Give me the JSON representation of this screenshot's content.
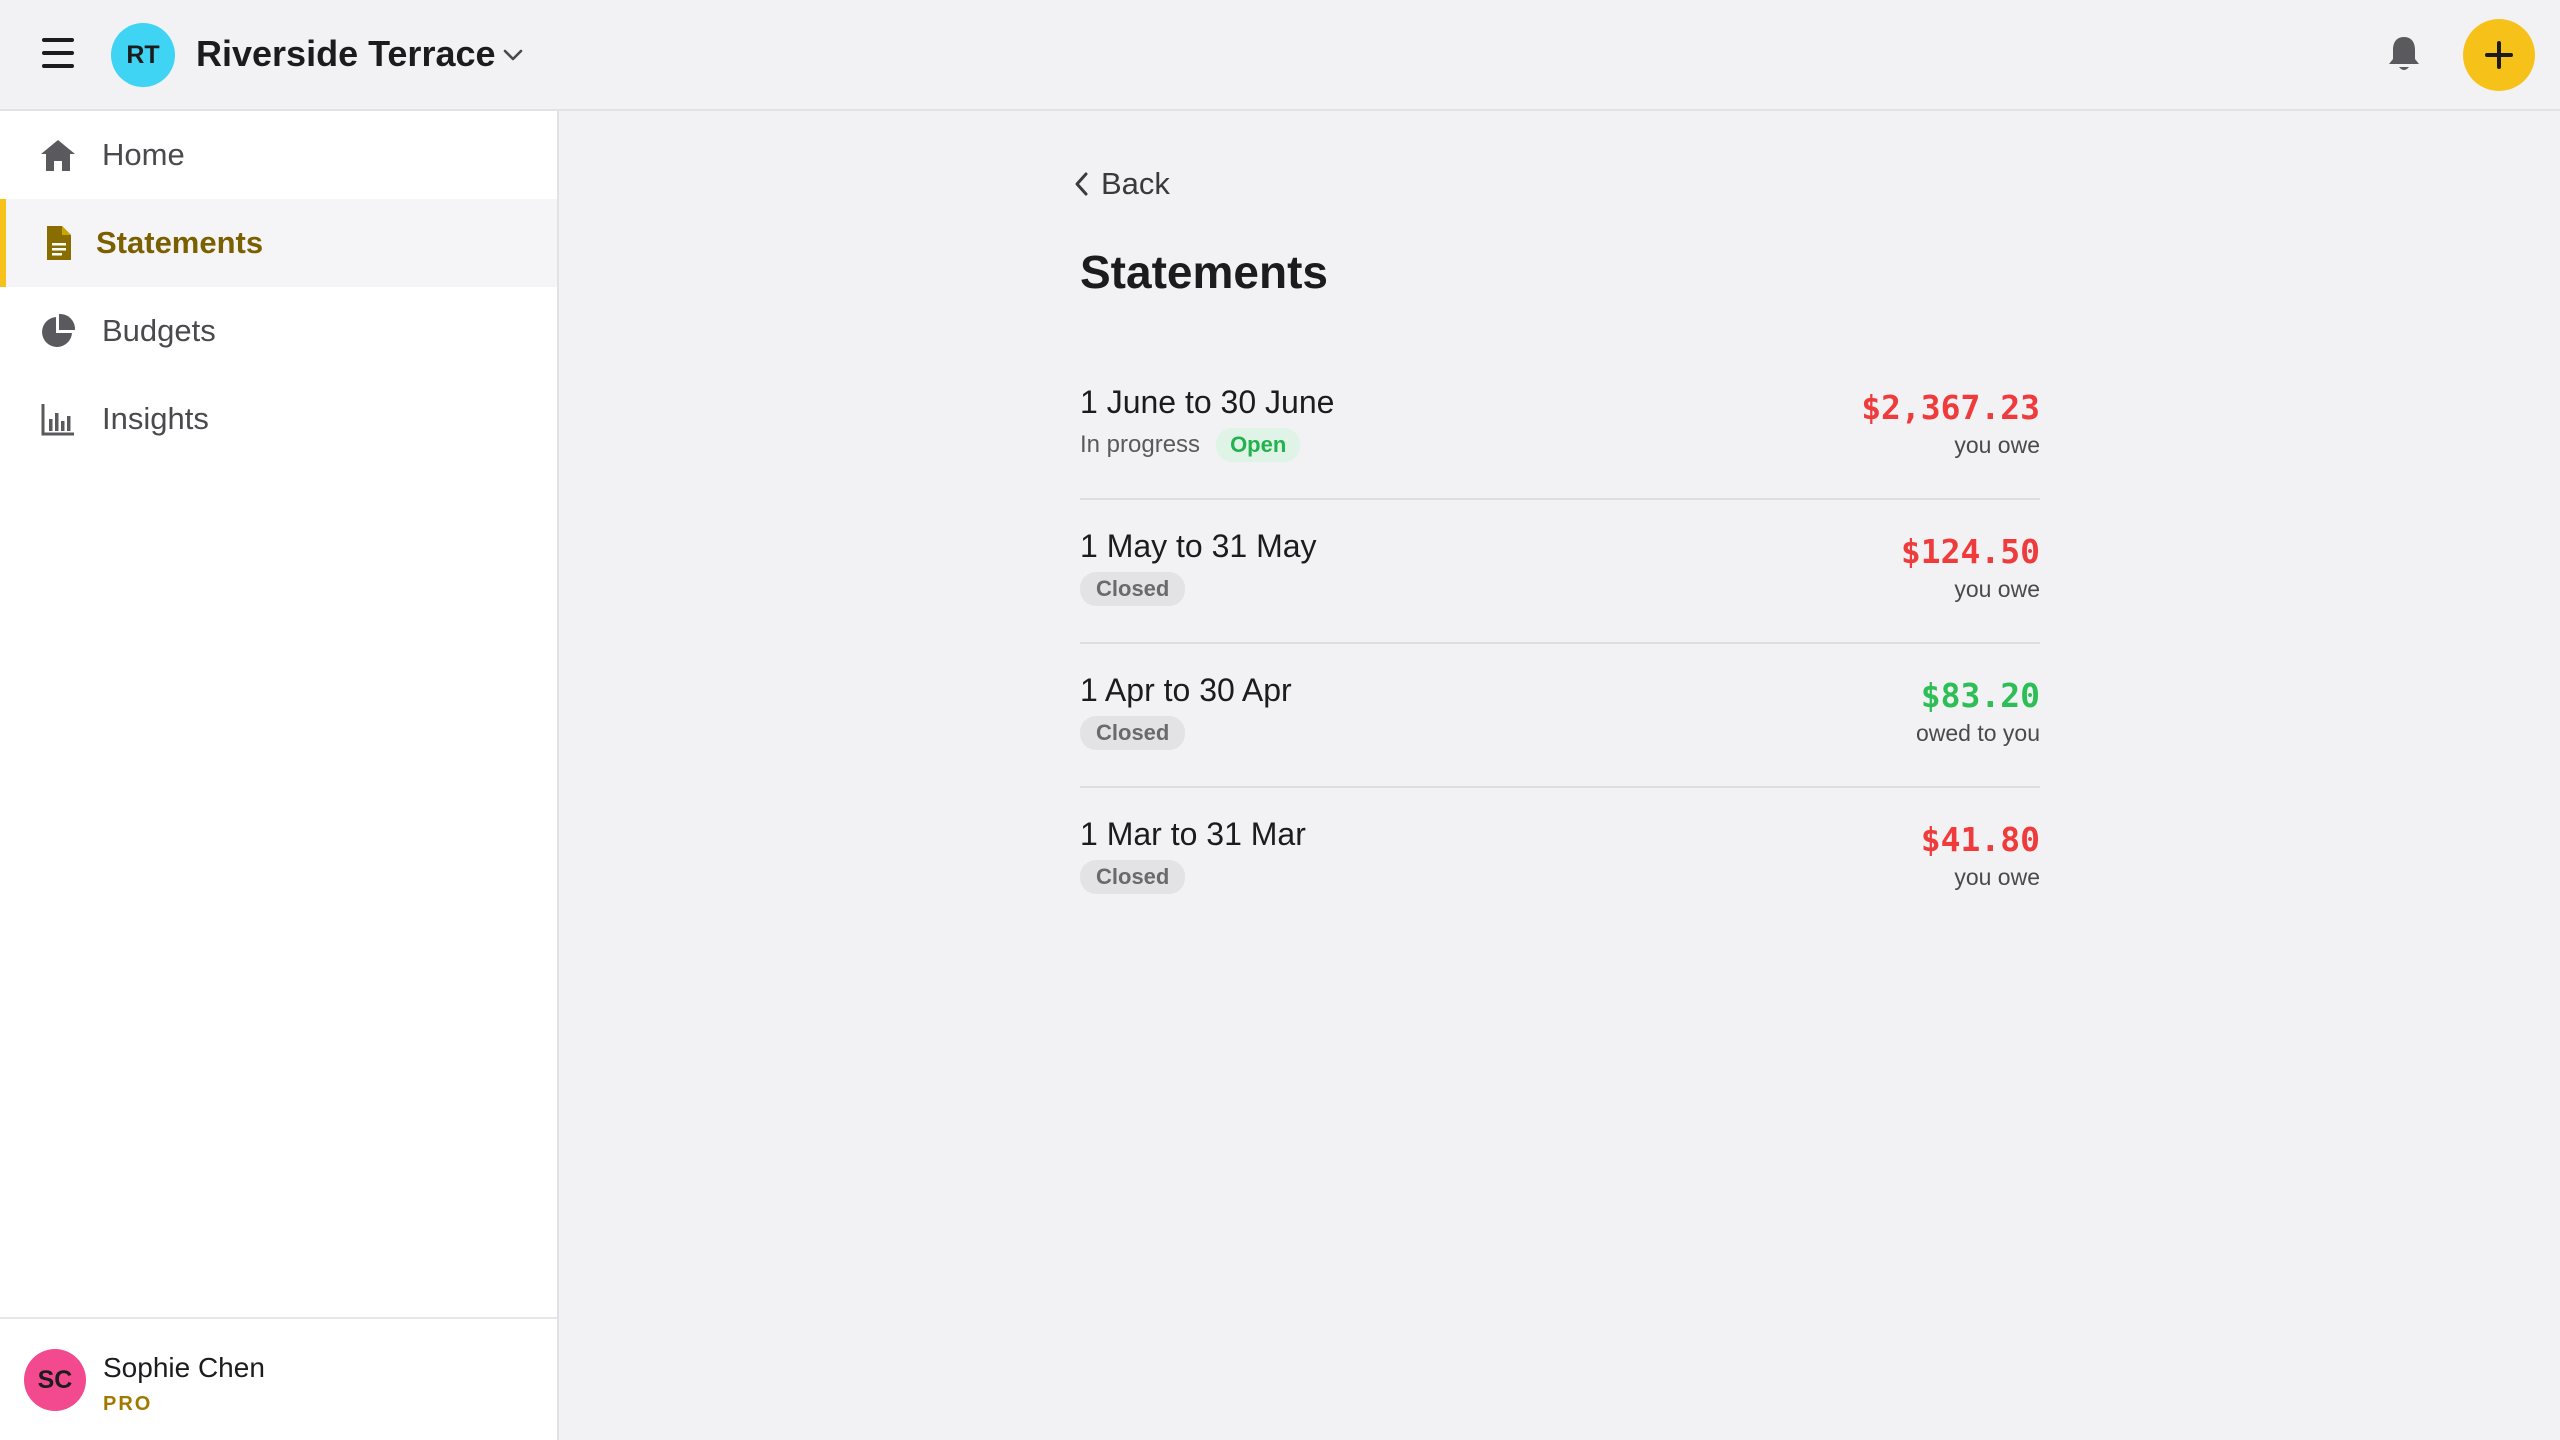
{
  "header": {
    "group_initials": "RT",
    "group_name": "Riverside Terrace",
    "accent_color": "#f6c219"
  },
  "sidebar": {
    "items": [
      {
        "label": "Home",
        "icon": "home-icon"
      },
      {
        "label": "Statements",
        "icon": "document-icon",
        "active": true
      },
      {
        "label": "Budgets",
        "icon": "pie-chart-icon"
      },
      {
        "label": "Insights",
        "icon": "bar-chart-icon"
      }
    ],
    "user": {
      "initials": "SC",
      "name": "Sophie Chen",
      "plan": "PRO"
    }
  },
  "main": {
    "back_label": "Back",
    "title": "Statements",
    "statements": [
      {
        "period": "1 June to 30 June",
        "progress": "In progress",
        "status": "Open",
        "amount": "$2,367.23",
        "note": "you owe"
      },
      {
        "period": "1 May to 31 May",
        "status": "Closed",
        "amount": "$124.50",
        "note": "you owe"
      },
      {
        "period": "1 Apr to 30 Apr",
        "status": "Closed",
        "amount": "$83.20",
        "note": "owed to you"
      },
      {
        "period": "1 Mar to 31 Mar",
        "status": "Closed",
        "amount": "$41.80",
        "note": "you owe"
      }
    ]
  }
}
